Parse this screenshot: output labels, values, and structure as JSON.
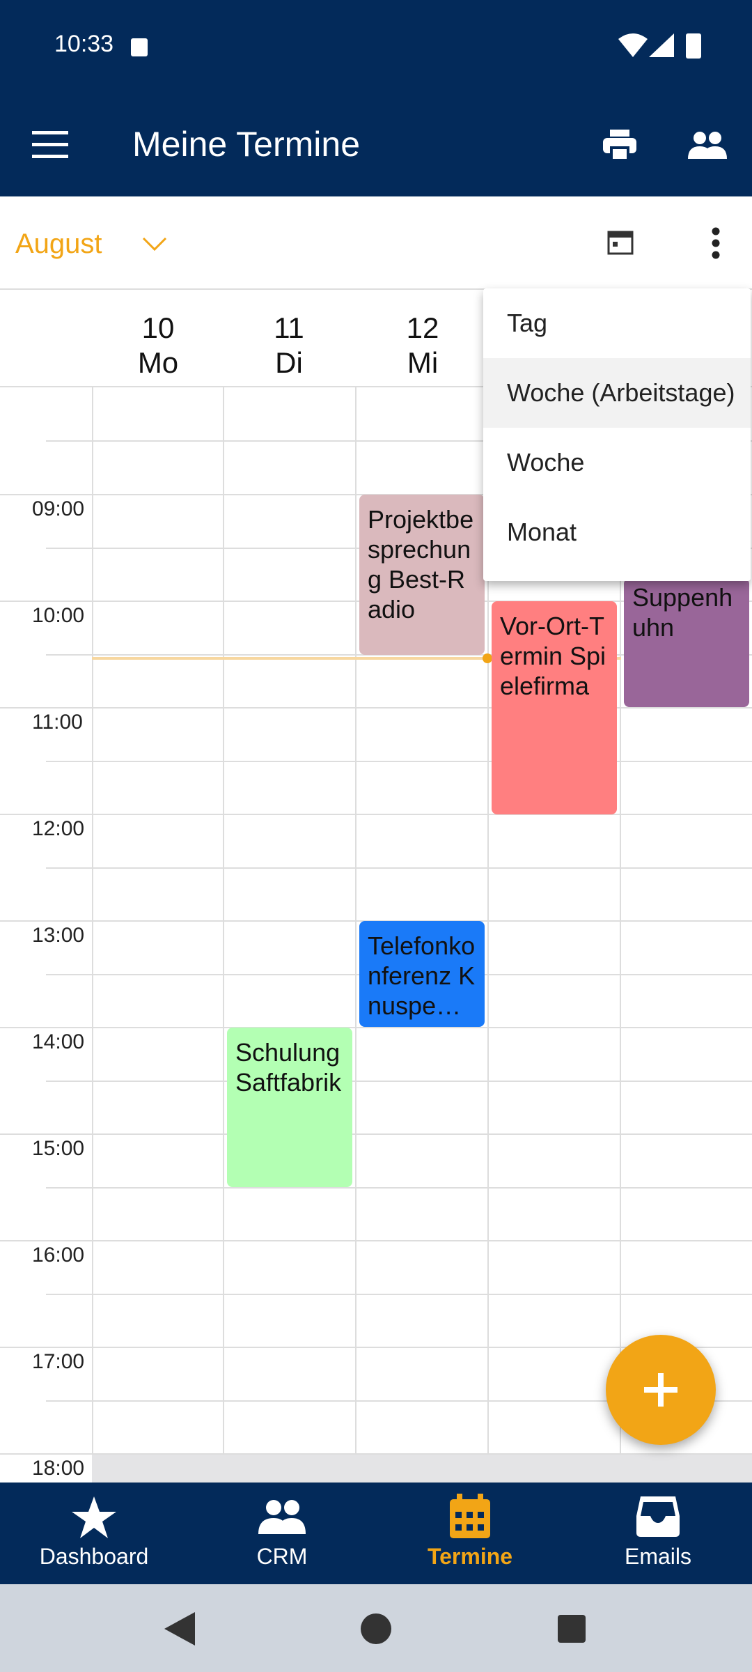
{
  "status_bar": {
    "time": "10:33"
  },
  "app_bar": {
    "title": "Meine Termine"
  },
  "toolbar": {
    "month": "August"
  },
  "days": [
    {
      "num": "10",
      "name": "Mo"
    },
    {
      "num": "11",
      "name": "Di"
    },
    {
      "num": "12",
      "name": "Mi"
    }
  ],
  "hours": [
    "09:00",
    "10:00",
    "11:00",
    "12:00",
    "13:00",
    "14:00",
    "15:00",
    "16:00",
    "17:00",
    "18:00"
  ],
  "events": [
    {
      "title": "Projektbesprechung Best-Radio",
      "color": "#dab9bd"
    },
    {
      "title": "Vor-Ort-Termin Spielefirma",
      "color": "#ff7f80"
    },
    {
      "title": "Suppenhuhn",
      "color": "#996699"
    },
    {
      "title": "Telefonkonferenz Knuspe…",
      "color": "#1a7af8"
    },
    {
      "title": "Schulung Saftfabrik",
      "color": "#b3ffb3"
    }
  ],
  "menu": {
    "items": [
      "Tag",
      "Woche (Arbeitstage)",
      "Woche",
      "Monat"
    ]
  },
  "bottom_nav": {
    "items": [
      {
        "label": "Dashboard",
        "icon": "star-icon"
      },
      {
        "label": "CRM",
        "icon": "people-icon"
      },
      {
        "label": "Termine",
        "icon": "calendar-icon"
      },
      {
        "label": "Emails",
        "icon": "inbox-icon"
      }
    ],
    "active": "Termine"
  },
  "colors": {
    "primary": "#032a5a",
    "accent": "#f2a516"
  }
}
